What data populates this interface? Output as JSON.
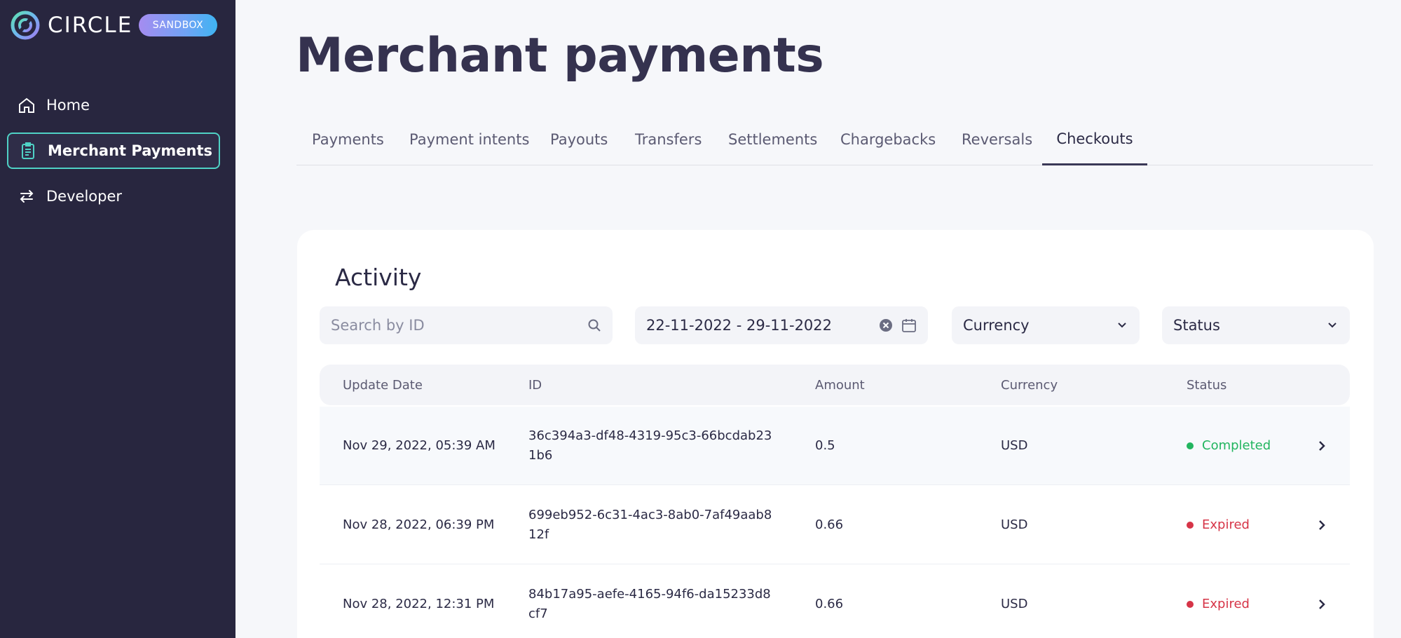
{
  "app": {
    "logo_text": "CIRCLE",
    "badge": "SANDBOX",
    "colors": {
      "sidebar_bg": "#28263f",
      "active_border": "#4fd1c5",
      "completed": "#22b55f",
      "expired": "#d63447"
    }
  },
  "sidebar": {
    "items": [
      {
        "label": "Home",
        "icon": "home-icon"
      },
      {
        "label": "Merchant Payments",
        "icon": "clipboard-icon"
      },
      {
        "label": "Developer",
        "icon": "arrows-exchange-icon"
      }
    ]
  },
  "main": {
    "title": "Merchant payments",
    "tabs": [
      {
        "label": "Payments"
      },
      {
        "label": "Payment intents"
      },
      {
        "label": "Payouts"
      },
      {
        "label": "Transfers"
      },
      {
        "label": "Settlements"
      },
      {
        "label": "Chargebacks"
      },
      {
        "label": "Reversals"
      },
      {
        "label": "Checkouts"
      }
    ],
    "active_tab": "Checkouts"
  },
  "activity": {
    "title": "Activity",
    "search_placeholder": "Search by ID",
    "date_range": "22-11-2022 - 29-11-2022",
    "currency_select": "Currency",
    "status_select": "Status",
    "columns": [
      "Update Date",
      "ID",
      "Amount",
      "Currency",
      "Status"
    ],
    "rows": [
      {
        "date": "Nov 29, 2022, 05:39 AM",
        "id": "36c394a3-df48-4319-95c3-66bcdab231b6",
        "amount": "0.5",
        "currency": "USD",
        "status": "Completed"
      },
      {
        "date": "Nov 28, 2022, 06:39 PM",
        "id": "699eb952-6c31-4ac3-8ab0-7af49aab812f",
        "amount": "0.66",
        "currency": "USD",
        "status": "Expired"
      },
      {
        "date": "Nov 28, 2022, 12:31 PM",
        "id": "84b17a95-aefe-4165-94f6-da15233d8cf7",
        "amount": "0.66",
        "currency": "USD",
        "status": "Expired"
      }
    ]
  }
}
